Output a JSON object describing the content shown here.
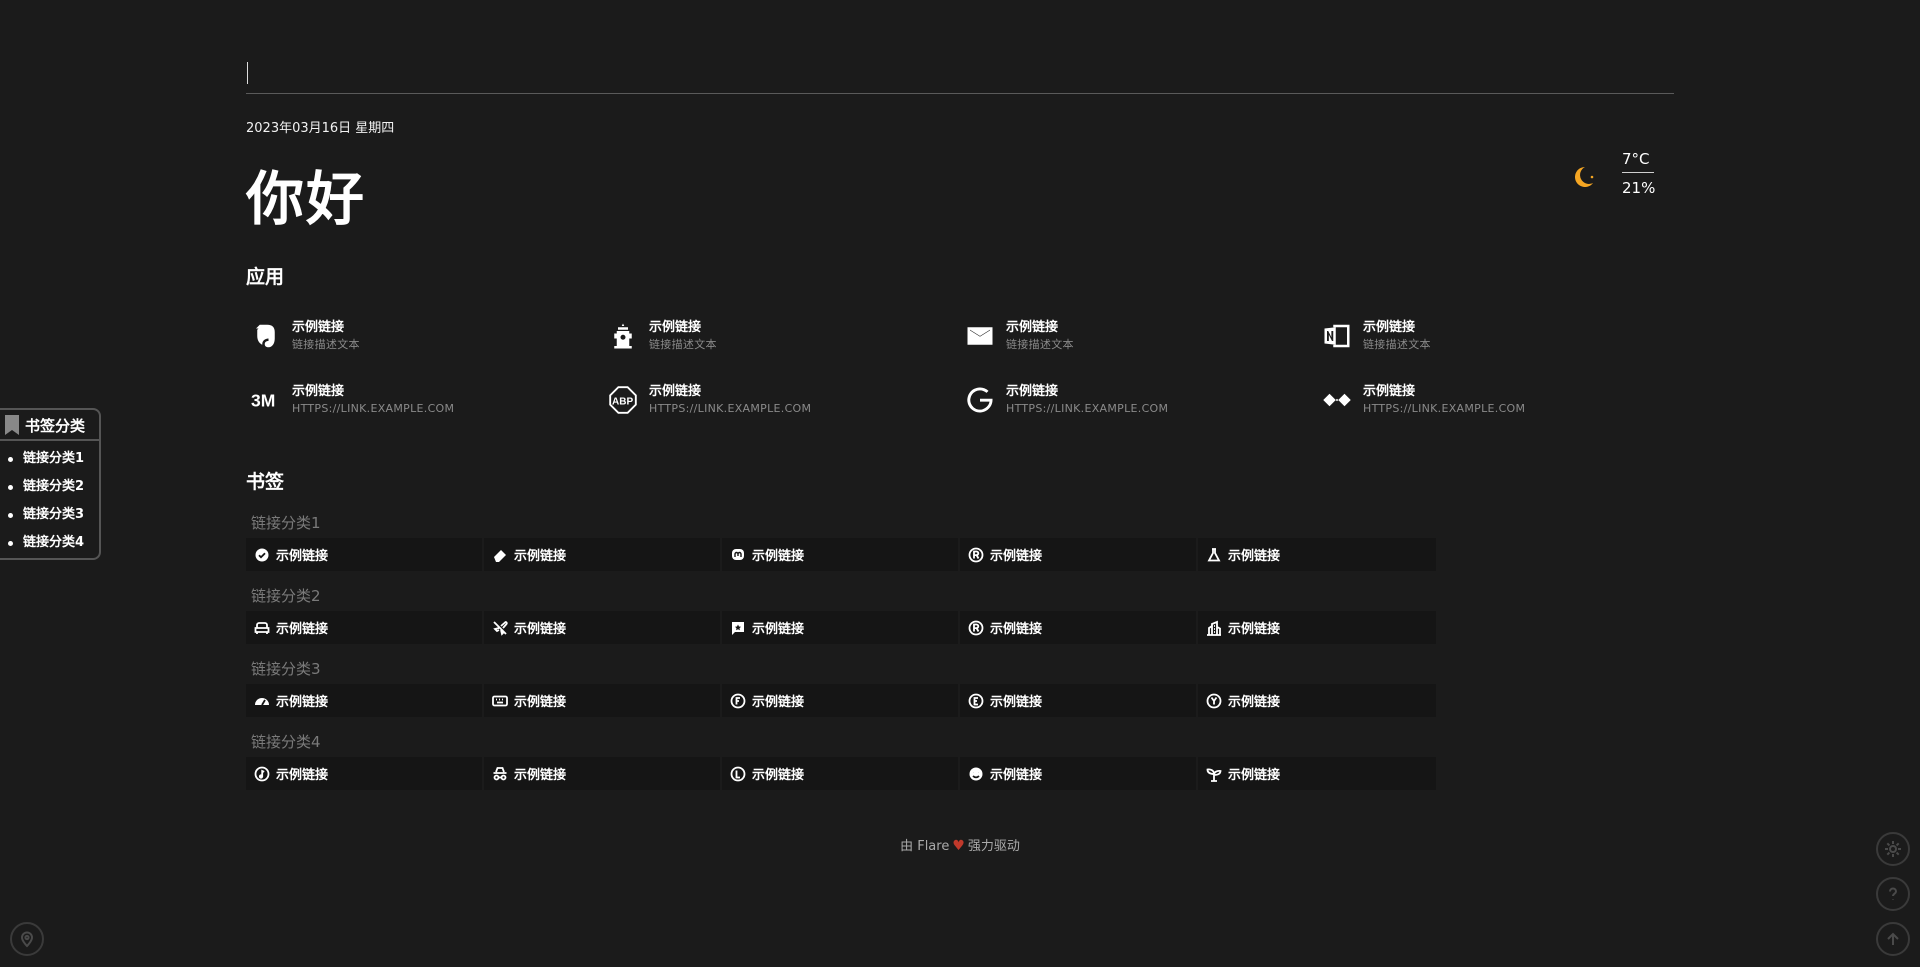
{
  "search": {
    "placeholder": "",
    "value": ""
  },
  "header": {
    "date": "2023年03月16日 星期四",
    "greeting": "你好"
  },
  "weather": {
    "icon": "moon-icon",
    "temperature": "7°C",
    "humidity": "21%",
    "icon_color": "#f5a623"
  },
  "apps": {
    "title": "应用",
    "items": [
      {
        "name": "示例链接",
        "desc": "链接描述文本",
        "icon": "evernote-icon"
      },
      {
        "name": "示例链接",
        "desc": "链接描述文本",
        "icon": "fire-hydrant-icon"
      },
      {
        "name": "示例链接",
        "desc": "链接描述文本",
        "icon": "mail-icon"
      },
      {
        "name": "示例链接",
        "desc": "链接描述文本",
        "icon": "onenote-icon"
      },
      {
        "name": "示例链接",
        "desc": "HTTPS://LINK.EXAMPLE.COM",
        "icon": "3m-icon"
      },
      {
        "name": "示例链接",
        "desc": "HTTPS://LINK.EXAMPLE.COM",
        "icon": "adblock-icon"
      },
      {
        "name": "示例链接",
        "desc": "HTTPS://LINK.EXAMPLE.COM",
        "icon": "google-icon"
      },
      {
        "name": "示例链接",
        "desc": "HTTPS://LINK.EXAMPLE.COM",
        "icon": "diamond-icon"
      }
    ]
  },
  "bookmarks": {
    "title": "书签",
    "categories": [
      {
        "title": "链接分类1",
        "items": [
          {
            "label": "示例链接",
            "icon": "check-badge-icon"
          },
          {
            "label": "示例链接",
            "icon": "eraser-icon"
          },
          {
            "label": "示例链接",
            "icon": "mastodon-icon"
          },
          {
            "label": "示例链接",
            "icon": "registered-icon"
          },
          {
            "label": "示例链接",
            "icon": "flask-icon"
          }
        ]
      },
      {
        "title": "链接分类2",
        "items": [
          {
            "label": "示例链接",
            "icon": "sofa-icon"
          },
          {
            "label": "示例链接",
            "icon": "plane-off-icon"
          },
          {
            "label": "示例链接",
            "icon": "message-star-icon"
          },
          {
            "label": "示例链接",
            "icon": "registered-icon"
          },
          {
            "label": "示例链接",
            "icon": "building-icon"
          }
        ]
      },
      {
        "title": "链接分类3",
        "items": [
          {
            "label": "示例链接",
            "icon": "gauge-icon"
          },
          {
            "label": "示例链接",
            "icon": "keyboard-icon"
          },
          {
            "label": "示例链接",
            "icon": "letter-f-circle-icon"
          },
          {
            "label": "示例链接",
            "icon": "letter-e-circle-icon"
          },
          {
            "label": "示例链接",
            "icon": "letter-y-circle-icon"
          }
        ]
      },
      {
        "title": "链接分类4",
        "items": [
          {
            "label": "示例链接",
            "icon": "music-circle-icon"
          },
          {
            "label": "示例链接",
            "icon": "incognito-icon"
          },
          {
            "label": "示例链接",
            "icon": "letter-l-circle-icon"
          },
          {
            "label": "示例链接",
            "icon": "mood-icon"
          },
          {
            "label": "示例链接",
            "icon": "plant-icon"
          }
        ]
      }
    ]
  },
  "toc": {
    "title": "书签分类",
    "items": [
      "链接分类1",
      "链接分类2",
      "链接分类3",
      "链接分类4"
    ]
  },
  "footer": {
    "prefix": "由 Flare",
    "suffix": "强力驱动",
    "heart_color": "#c0392b"
  },
  "colors": {
    "background": "#1b1b1b",
    "bookmark_bg": "#151515",
    "muted": "#8a8a8a"
  }
}
